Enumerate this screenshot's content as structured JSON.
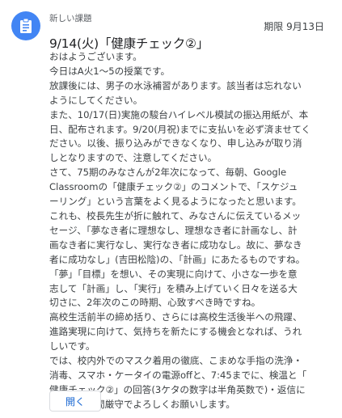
{
  "assignment": {
    "kicker": "新しい課題",
    "due": "期限 9月13日",
    "title": "9/14(火)「健康チェック②」",
    "body": "おはようございます。\n今日はA火1〜5の授業です。\n放課後には、男子の水泳補習があります。該当者は忘れない\nようにしてください。\nまた、10/17(日)実施の駿台ハイレベル模試の振込用紙が、本\n日、配布されます。9/20(月祝)までに支払いを必ず済ませてく\nださい。以後、振り込みができなくなり、申し込みが取り消\nしとなりますので、注意してください。\nさて、75期のみなさんが2年次になって、毎朝、Google\nClassroomの「健康チェック②」のコメントで、「スケジュ\nーリング」という言葉をよく見るようになったと思います。\nこれも、校長先生が折に触れて、みなさんに伝えているメッ\nセージ、「夢なき者に理想なし、理想なき者に計画なし、計\n画なき者に実行なし、実行なき者に成功なし。故に、夢なき\n者に成功なし」(吉田松陰)の、「計画」にあたるものですね。\n「夢」「目標」を想い、その実現に向けて、小さな一歩を意\n志して「計画」し、「実行」を積み上げていく日々を送る大\n切さに、2年次のこの時期、心致すべき時ですね。\n高校生活前半の締め括り、さらには高校生活後半への飛躍、\n進路実現に向けて、気持ちを新たにする機会となれば、うれ\nしいです。\nでは、校内外でのマスク着用の徹底、こまめな手指の洗浄・\n消毒、スマホ・ケータイの電源offと、7:45までに、検温と「\n健康チェック②」の回答(3ケタの数字は半角英数で)・返信に\nついて、時間厳守でよろしくお願いします。",
    "open_button": "開く"
  },
  "icons": {
    "assignment_icon": "assignment-clipboard-icon"
  },
  "colors": {
    "accent": "#4285f4",
    "button_text": "#1967d2"
  }
}
